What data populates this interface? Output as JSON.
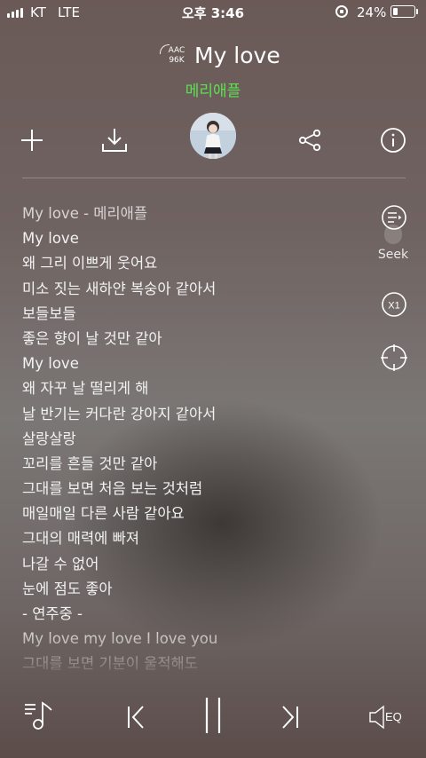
{
  "status_bar": {
    "carrier": "KT",
    "network": "LTE",
    "time": "오후 3:46",
    "battery": "24%",
    "battery_level": 0.24
  },
  "track": {
    "codec_line1": "AAC",
    "codec_line2": "96K",
    "title": "My love",
    "artist": "메리애플"
  },
  "actions": {
    "icons": [
      "plus-icon",
      "download-icon",
      "album-art",
      "share-icon",
      "info-icon"
    ]
  },
  "lyrics": [
    "My love - 메리애플",
    "My love",
    "왜 그리 이쁘게 웃어요",
    "미소 짓는 새하얀 복숭아 같아서",
    "보들보들",
    "좋은 향이 날 것만 같아",
    "My love",
    "왜 자꾸 날 떨리게 해",
    "날 반기는 커다란 강아지 같아서",
    "살랑살랑",
    "꼬리를 흔들 것만 같아",
    "그대를 보면 처음 보는 것처럼",
    "매일매일 다른 사람 같아요",
    "그대의 매력에 빠져",
    "나갈 수 없어",
    "눈에 점도 좋아",
    " - 연주중 -",
    "My love my love I love you",
    "그대를 보면 기분이 울적해도"
  ],
  "side_controls": {
    "seek_label": "Seek",
    "speed_label": "X1"
  },
  "bottom_controls": {
    "eq_label": "EQ"
  },
  "colors": {
    "artist": "#5ee052",
    "text": "#ffffff"
  }
}
